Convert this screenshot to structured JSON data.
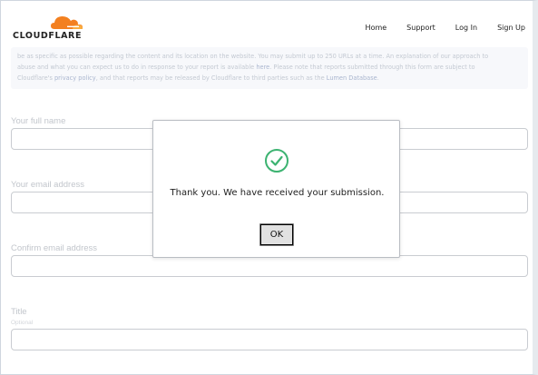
{
  "brand": {
    "name": "CLOUDFLARE",
    "accent": "#f38020",
    "accent_light": "#faad3f"
  },
  "nav": {
    "items": [
      "Home",
      "Support",
      "Log In",
      "Sign Up"
    ]
  },
  "intro": {
    "line1": "be as specific as possible regarding the content and its location on the website. You may submit up to 250 URLs at a time. An explanation of our approach to",
    "line2_a": "abuse and what you can expect us to do in response to your report is available ",
    "line2_link": "here",
    "line2_b": ". Please note that reports submitted through this form are subject to",
    "line3_a": "Cloudflare's ",
    "line3_link1": "privacy policy",
    "line3_b": ", and that reports may be released by Cloudflare to third parties such as the ",
    "line3_link2": "Lumen Database",
    "line3_c": "."
  },
  "form": {
    "full_name_label": "Your full name",
    "email_label": "Your email address",
    "confirm_email_label": "Confirm email address",
    "title_label": "Title",
    "title_hint": "Optional"
  },
  "dialog": {
    "message": "Thank you. We have received your submission.",
    "ok_label": "OK",
    "success_color": "#3cb371"
  }
}
